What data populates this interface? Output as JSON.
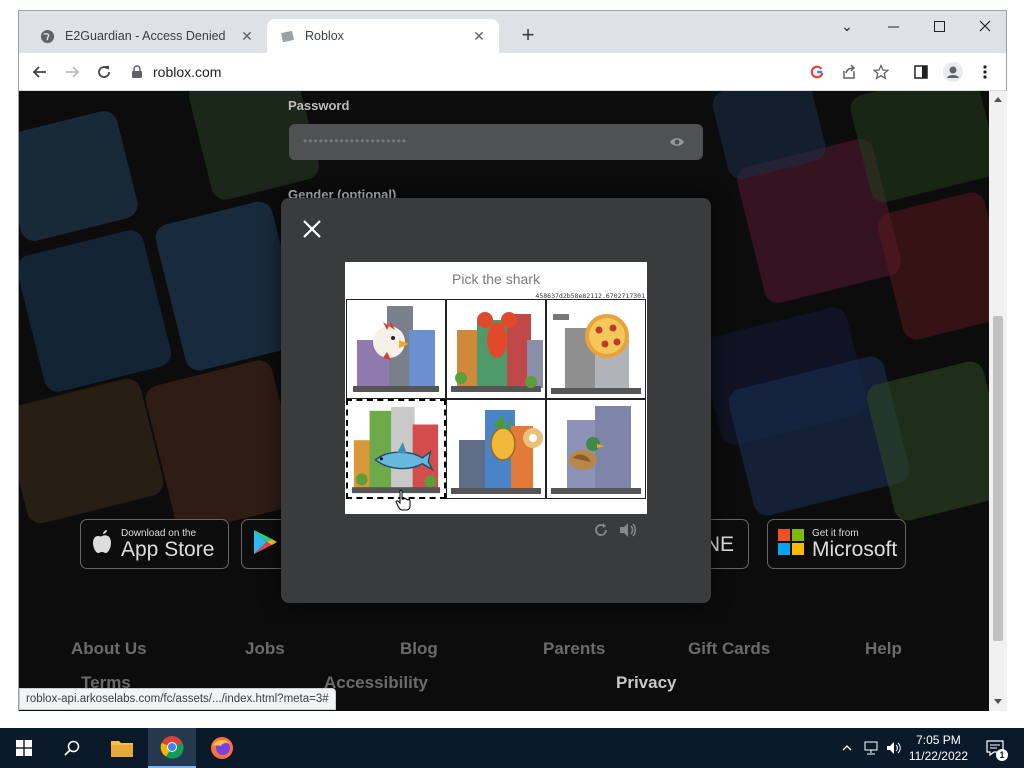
{
  "browser": {
    "tabs": [
      {
        "title": "E2Guardian - Access Denied",
        "icon": "globe-icon"
      },
      {
        "title": "Roblox",
        "icon": "roblox-favicon-icon"
      }
    ],
    "url": "roblox.com",
    "status_url": "roblox-api.arkoselabs.com/fc/assets/.../index.html?meta=3#"
  },
  "signup_form": {
    "password_label": "Password",
    "password_value": "••••••••••••••••••••",
    "gender_label": "Gender (optional)"
  },
  "captcha": {
    "prompt": "Pick the shark",
    "challenge_id": "458637d2b58e82112.6702717301",
    "tiles": [
      {
        "subject": "chicken",
        "selected": false
      },
      {
        "subject": "lobster",
        "selected": false
      },
      {
        "subject": "pizza",
        "selected": false
      },
      {
        "subject": "shark",
        "selected": true
      },
      {
        "subject": "pineapple",
        "selected": false
      },
      {
        "subject": "duck",
        "selected": false
      }
    ]
  },
  "store_buttons": {
    "appstore_small": "Download on the",
    "appstore_big": "App Store",
    "microsoft_small": "Get it from",
    "microsoft_big": "Microsoft",
    "partial_text": "NE"
  },
  "footer": {
    "links": [
      "About Us",
      "Jobs",
      "Blog",
      "Parents",
      "Gift Cards",
      "Help"
    ],
    "links2": [
      "Terms",
      "Accessibility",
      "Privacy"
    ]
  },
  "taskbar": {
    "time": "7:05 PM",
    "date": "11/22/2022",
    "notification_count": "1"
  },
  "colors": {
    "modal_bg": "#3a3b3c",
    "taskbar_bg": "#0b1a2b",
    "tab_strip": "#dee1e6"
  }
}
